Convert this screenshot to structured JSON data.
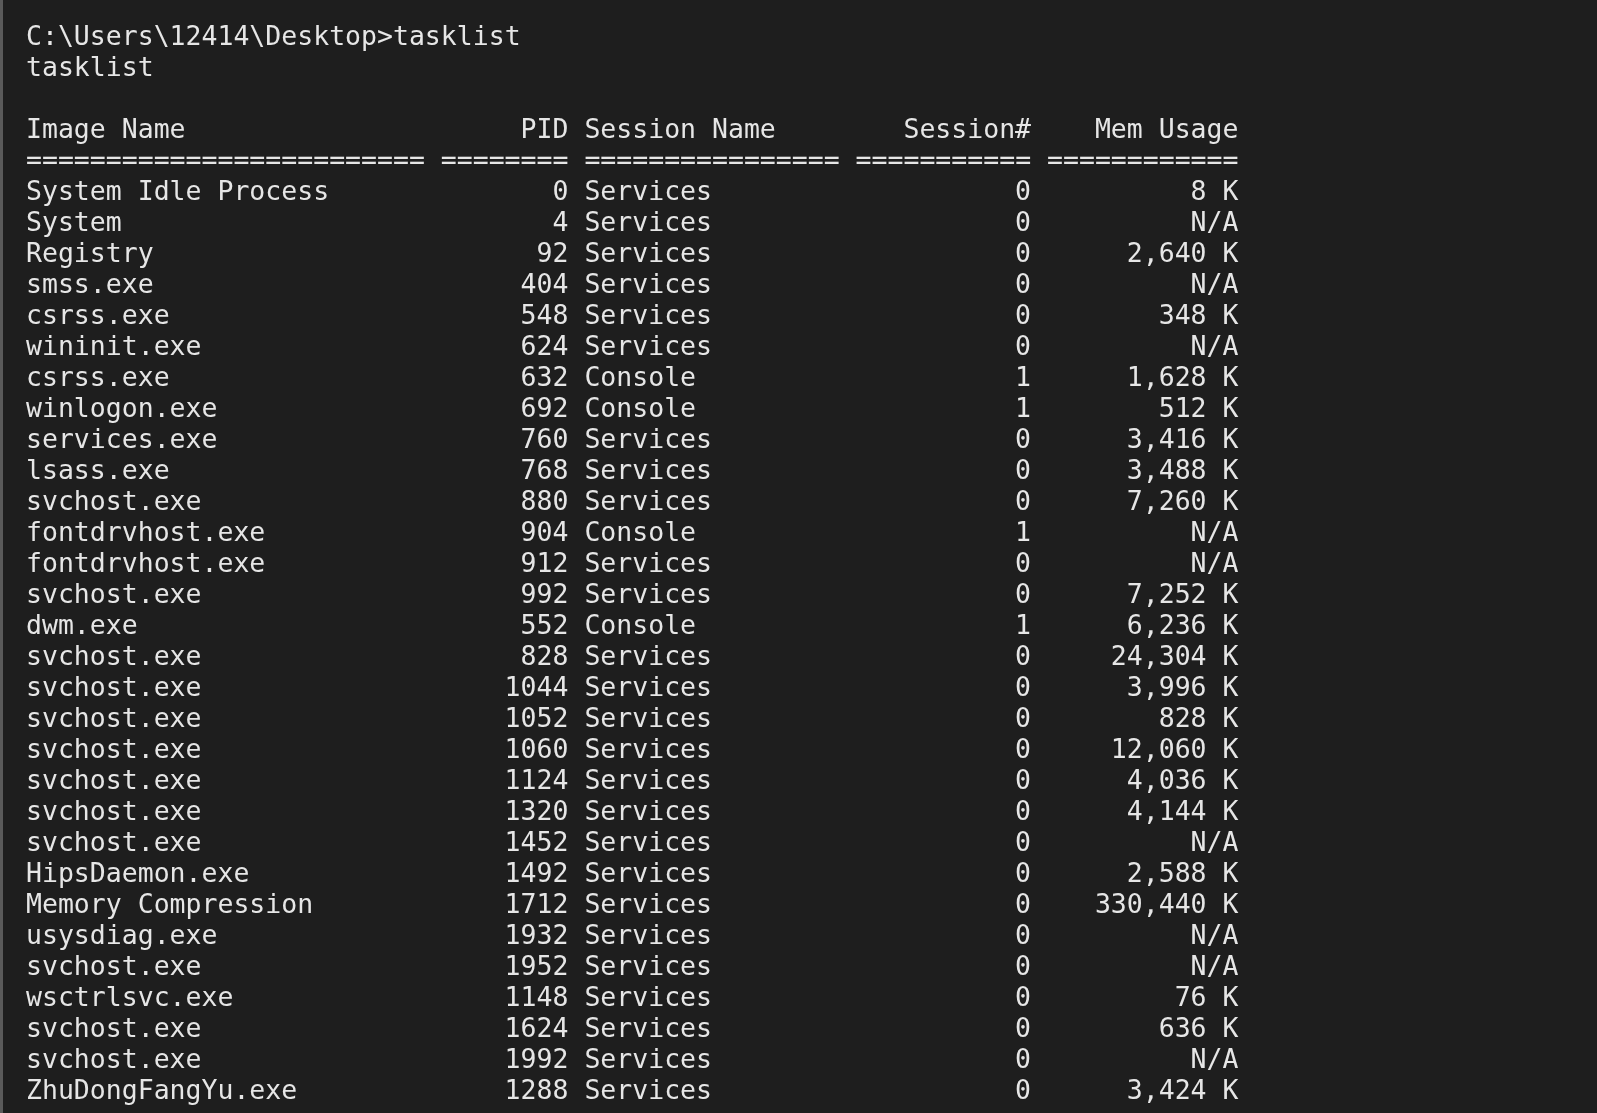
{
  "console": {
    "lines": [
      "C:\\Users\\12414\\Desktop>tasklist",
      "tasklist"
    ],
    "columns": [
      "Image Name",
      "PID",
      "Session Name",
      "Session#",
      "Mem Usage"
    ],
    "separators": [
      "=========================",
      "========",
      "================",
      "===========",
      "============"
    ],
    "rows": [
      {
        "image": "System Idle Process",
        "pid": "0",
        "session": "Services",
        "session_no": "0",
        "mem": "8 K"
      },
      {
        "image": "System",
        "pid": "4",
        "session": "Services",
        "session_no": "0",
        "mem": "N/A"
      },
      {
        "image": "Registry",
        "pid": "92",
        "session": "Services",
        "session_no": "0",
        "mem": "2,640 K"
      },
      {
        "image": "smss.exe",
        "pid": "404",
        "session": "Services",
        "session_no": "0",
        "mem": "N/A"
      },
      {
        "image": "csrss.exe",
        "pid": "548",
        "session": "Services",
        "session_no": "0",
        "mem": "348 K"
      },
      {
        "image": "wininit.exe",
        "pid": "624",
        "session": "Services",
        "session_no": "0",
        "mem": "N/A"
      },
      {
        "image": "csrss.exe",
        "pid": "632",
        "session": "Console",
        "session_no": "1",
        "mem": "1,628 K"
      },
      {
        "image": "winlogon.exe",
        "pid": "692",
        "session": "Console",
        "session_no": "1",
        "mem": "512 K"
      },
      {
        "image": "services.exe",
        "pid": "760",
        "session": "Services",
        "session_no": "0",
        "mem": "3,416 K"
      },
      {
        "image": "lsass.exe",
        "pid": "768",
        "session": "Services",
        "session_no": "0",
        "mem": "3,488 K"
      },
      {
        "image": "svchost.exe",
        "pid": "880",
        "session": "Services",
        "session_no": "0",
        "mem": "7,260 K"
      },
      {
        "image": "fontdrvhost.exe",
        "pid": "904",
        "session": "Console",
        "session_no": "1",
        "mem": "N/A"
      },
      {
        "image": "fontdrvhost.exe",
        "pid": "912",
        "session": "Services",
        "session_no": "0",
        "mem": "N/A"
      },
      {
        "image": "svchost.exe",
        "pid": "992",
        "session": "Services",
        "session_no": "0",
        "mem": "7,252 K"
      },
      {
        "image": "dwm.exe",
        "pid": "552",
        "session": "Console",
        "session_no": "1",
        "mem": "6,236 K"
      },
      {
        "image": "svchost.exe",
        "pid": "828",
        "session": "Services",
        "session_no": "0",
        "mem": "24,304 K"
      },
      {
        "image": "svchost.exe",
        "pid": "1044",
        "session": "Services",
        "session_no": "0",
        "mem": "3,996 K"
      },
      {
        "image": "svchost.exe",
        "pid": "1052",
        "session": "Services",
        "session_no": "0",
        "mem": "828 K"
      },
      {
        "image": "svchost.exe",
        "pid": "1060",
        "session": "Services",
        "session_no": "0",
        "mem": "12,060 K"
      },
      {
        "image": "svchost.exe",
        "pid": "1124",
        "session": "Services",
        "session_no": "0",
        "mem": "4,036 K"
      },
      {
        "image": "svchost.exe",
        "pid": "1320",
        "session": "Services",
        "session_no": "0",
        "mem": "4,144 K"
      },
      {
        "image": "svchost.exe",
        "pid": "1452",
        "session": "Services",
        "session_no": "0",
        "mem": "N/A"
      },
      {
        "image": "HipsDaemon.exe",
        "pid": "1492",
        "session": "Services",
        "session_no": "0",
        "mem": "2,588 K"
      },
      {
        "image": "Memory Compression",
        "pid": "1712",
        "session": "Services",
        "session_no": "0",
        "mem": "330,440 K"
      },
      {
        "image": "usysdiag.exe",
        "pid": "1932",
        "session": "Services",
        "session_no": "0",
        "mem": "N/A"
      },
      {
        "image": "svchost.exe",
        "pid": "1952",
        "session": "Services",
        "session_no": "0",
        "mem": "N/A"
      },
      {
        "image": "wsctrlsvc.exe",
        "pid": "1148",
        "session": "Services",
        "session_no": "0",
        "mem": "76 K"
      },
      {
        "image": "svchost.exe",
        "pid": "1624",
        "session": "Services",
        "session_no": "0",
        "mem": "636 K"
      },
      {
        "image": "svchost.exe",
        "pid": "1992",
        "session": "Services",
        "session_no": "0",
        "mem": "N/A"
      },
      {
        "image": "ZhuDongFangYu.exe",
        "pid": "1288",
        "session": "Services",
        "session_no": "0",
        "mem": "3,424 K"
      }
    ]
  }
}
